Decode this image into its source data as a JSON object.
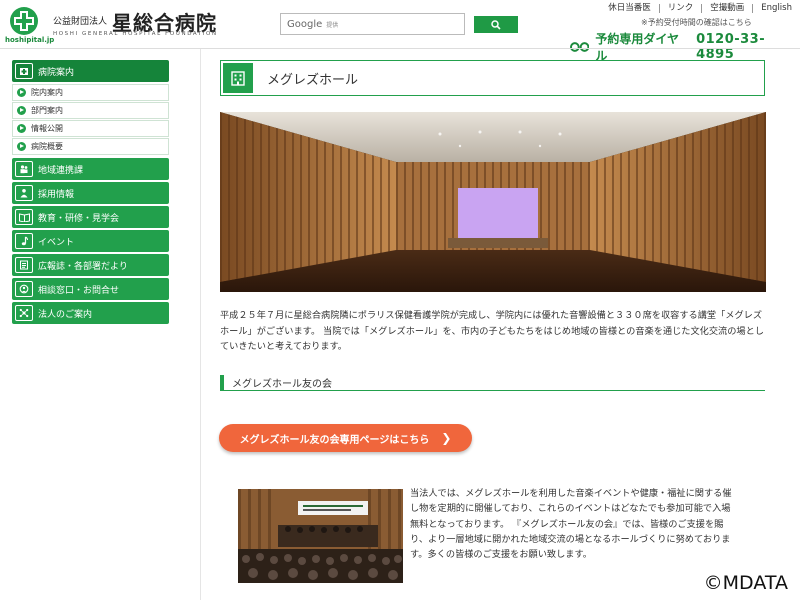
{
  "header": {
    "logo_domain": "hoshipital.jp",
    "org_prefix": "公益財団法人",
    "org_name": "星総合病院",
    "org_en": "HOSHI GENERAL HOSPITAL FOUNDATION",
    "search": {
      "logo": "Google",
      "hint": "提供"
    },
    "util_links": [
      "休日当番医",
      "リンク",
      "空撮動画",
      "English"
    ],
    "notice": "※予約受付時間の確認はこちら",
    "reservation_label": "予約専用ダイヤル",
    "reservation_tel": "0120-33-4895"
  },
  "sidebar": {
    "active": {
      "label": "病院案内",
      "icon": "hospital-icon"
    },
    "sub_items": [
      "院内案内",
      "部門案内",
      "情報公開",
      "病院概要"
    ],
    "items": [
      {
        "label": "地域連携課",
        "icon": "people-icon"
      },
      {
        "label": "採用情報",
        "icon": "recruit-icon"
      },
      {
        "label": "教育・研修・見学会",
        "icon": "book-icon"
      },
      {
        "label": "イベント",
        "icon": "music-icon"
      },
      {
        "label": "広報誌・各部署だより",
        "icon": "newsletter-icon"
      },
      {
        "label": "相談窓口・お問合せ",
        "icon": "consult-icon"
      },
      {
        "label": "法人のご案内",
        "icon": "network-icon"
      }
    ]
  },
  "main": {
    "title": "メグレズホール",
    "intro": "平成２５年７月に星総合病院隣にポラリス保健看護学院が完成し、学院内には優れた音響設備と３３０席を収容する講堂「メグレズホール」がございます。 当院では「メグレズホール」を、市内の子どもたちをはじめ地域の皆様との音楽を通じた文化交流の場としていきたいと考えております。",
    "section_heading": "メグレズホール友の会",
    "cta_label": "メグレズホール友の会専用ページはこちら",
    "body": "当法人では、メグレズホールを利用した音楽イベントや健康・福祉に関する催し物を定期的に開催しており、これらのイベントはどなたでも参加可能で入場無料となっております。 『メグレズホール友の会』では、皆様のご支援を賜り、より一層地域に開かれた地域交流の場となるホールづくりに努めております。多くの皆様のご支援をお願い致します。"
  },
  "watermark": "©MDATA",
  "colors": {
    "brand_green": "#22a04c",
    "cta_orange": "#f0663c"
  }
}
